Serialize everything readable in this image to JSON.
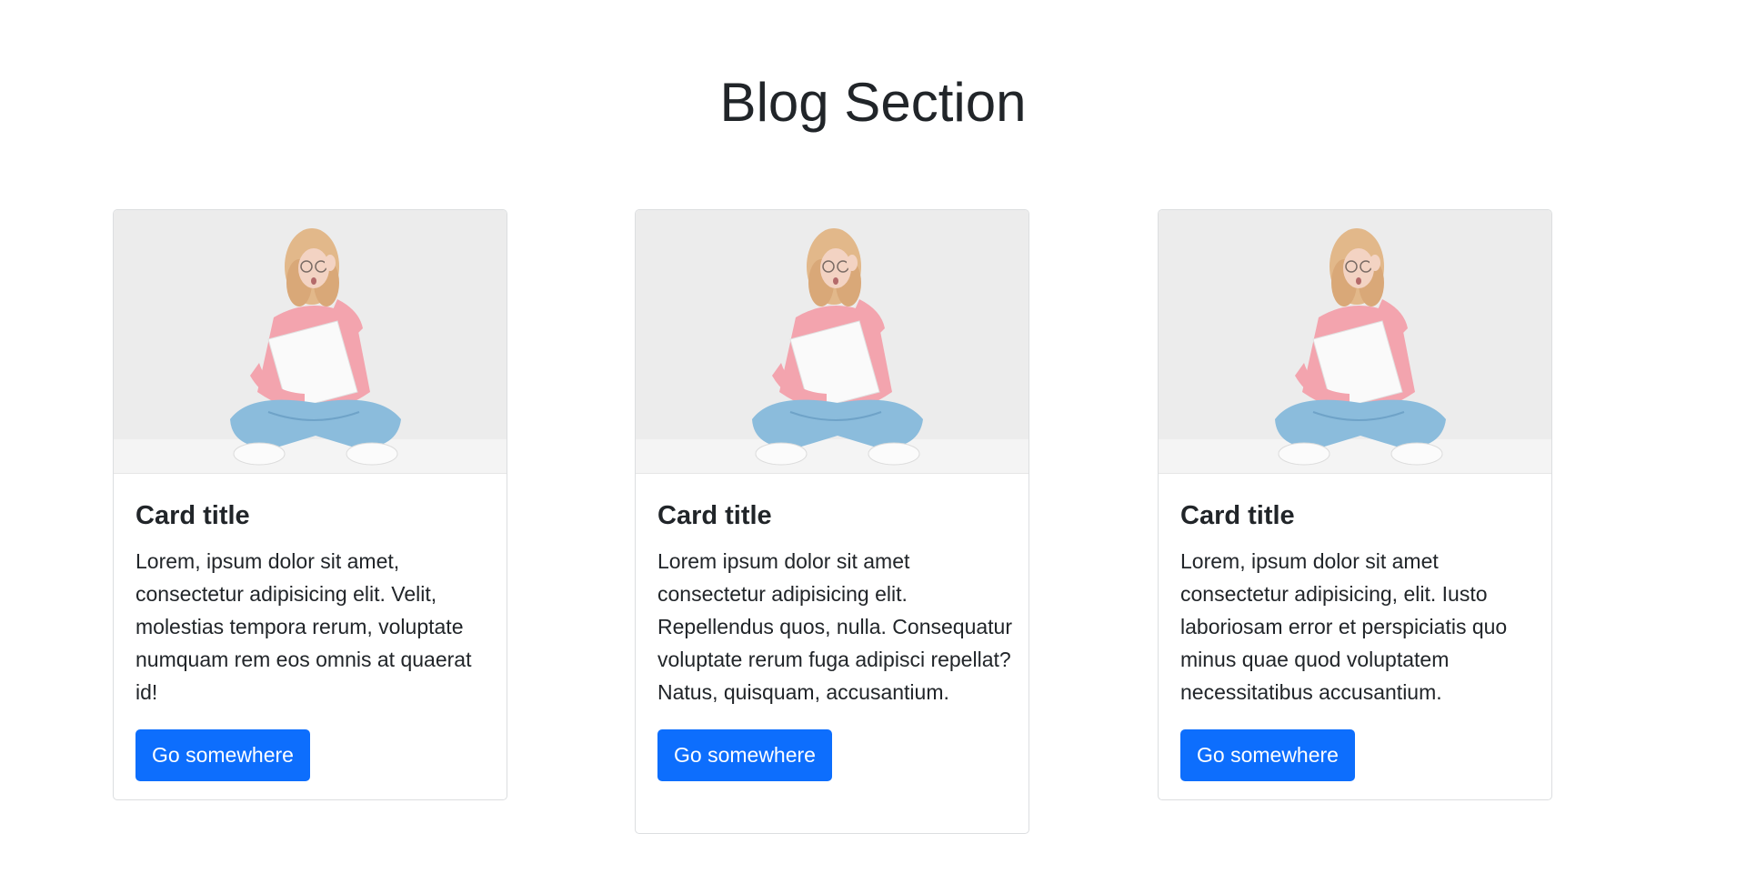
{
  "section": {
    "title": "Blog Section"
  },
  "cards": [
    {
      "title": "Card title",
      "text": "Lorem, ipsum dolor sit amet, consectetur adipisicing elit. Velit, molestias tempora rerum, voluptate numquam rem eos omnis at quaerat id!",
      "button_label": "Go somewhere"
    },
    {
      "title": "Card title",
      "text": "Lorem ipsum dolor sit amet consectetur adipisicing elit. Repellendus quos, nulla. Consequatur voluptate rerum fuga adipisci repellat? Natus, quisquam, accusantium.",
      "button_label": "Go somewhere"
    },
    {
      "title": "Card title",
      "text": "Lorem, ipsum dolor sit amet consectetur adipisicing, elit. Iusto laboriosam error et perspiciatis quo minus quae quod voluptatem necessitatibus accusantium.",
      "button_label": "Go somewhere"
    }
  ],
  "colors": {
    "button_bg": "#0d6efd",
    "button_text": "#ffffff",
    "heading": "#212529",
    "card_border": "#dcdee0"
  },
  "icons": {
    "card_image": "woman-with-laptop-photo"
  }
}
